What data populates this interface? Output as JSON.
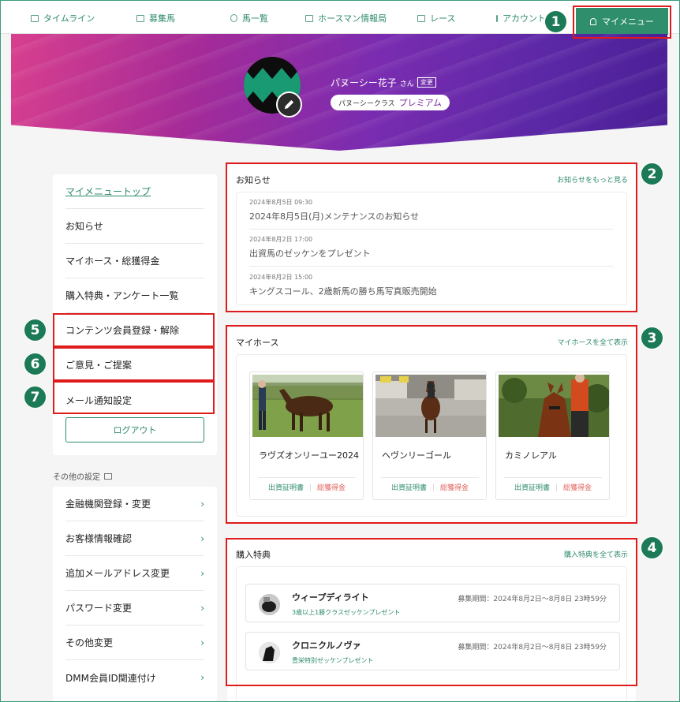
{
  "nav": {
    "items": [
      {
        "label": "タイムライン",
        "icon": "monitor-icon"
      },
      {
        "label": "募集馬",
        "icon": "folder-icon"
      },
      {
        "label": "馬一覧",
        "icon": "horseshoe-icon"
      },
      {
        "label": "ホースマン情報局",
        "icon": "news-icon"
      },
      {
        "label": "レース",
        "icon": "flag-icon"
      },
      {
        "label": "アカウント",
        "icon": "card-icon"
      }
    ],
    "mymenu_label": "マイメニュー"
  },
  "profile": {
    "name": "パヌーシー花子",
    "honorific": "さん",
    "change_label": "変更",
    "class_label": "パヌーシークラス",
    "class_tier": "プレミアム"
  },
  "sidebar": {
    "items": [
      {
        "label": "マイメニュートップ"
      },
      {
        "label": "お知らせ"
      },
      {
        "label": "マイホース・総獲得金"
      },
      {
        "label": "購入特典・アンケート一覧"
      },
      {
        "label": "コンテンツ会員登録・解除"
      },
      {
        "label": "ご意見・ご提案"
      },
      {
        "label": "メール通知設定"
      }
    ],
    "logout_label": "ログアウト",
    "other_label": "その他の設定",
    "other_items": [
      {
        "label": "金融機関登録・変更"
      },
      {
        "label": "お客様情報確認"
      },
      {
        "label": "追加メールアドレス変更"
      },
      {
        "label": "パスワード変更"
      },
      {
        "label": "その他変更"
      },
      {
        "label": "DMM会員ID関連付け"
      }
    ]
  },
  "news": {
    "title": "お知らせ",
    "more_label": "お知らせをもっと見る",
    "items": [
      {
        "date": "2024年8月5日 09:30",
        "text": "2024年8月5日(月)メンテナンスのお知らせ"
      },
      {
        "date": "2024年8月2日 17:00",
        "text": "出資馬のゼッケンをプレゼント"
      },
      {
        "date": "2024年8月2日 15:00",
        "text": "キングスコール、2歳新馬の勝ち馬写真販売開始"
      }
    ]
  },
  "myhorse": {
    "title": "マイホース",
    "more_label": "マイホースを全て表示",
    "horses": [
      {
        "name": "ラヴズオンリーユー2024",
        "cert_label": "出資証明書",
        "prize_label": "総獲得金"
      },
      {
        "name": "ヘヴンリーゴール",
        "cert_label": "出資証明書",
        "prize_label": "総獲得金"
      },
      {
        "name": "カミノレアル",
        "cert_label": "出資証明書",
        "prize_label": "総獲得金"
      }
    ]
  },
  "perks": {
    "title": "購入特典",
    "more_label": "購入特典を全て表示",
    "items": [
      {
        "name": "ウィープディライト",
        "sub": "3歳以上1勝クラスゼッケンプレゼント",
        "period": "募集期間：2024年8月2日～8月8日 23時59分"
      },
      {
        "name": "クロニクルノヴァ",
        "sub": "豊栄特別ゼッケンプレゼント",
        "period": "募集期間：2024年8月2日～8月8日 23時59分"
      }
    ]
  },
  "annotations": [
    "1",
    "2",
    "3",
    "4",
    "5",
    "6",
    "7"
  ],
  "colors": {
    "accent": "#2e8a6d",
    "annotation_red": "#e01b1b",
    "badge_green": "#1c7a57",
    "prize_red": "#e0605a",
    "premium_purple": "#7a2a9e"
  }
}
